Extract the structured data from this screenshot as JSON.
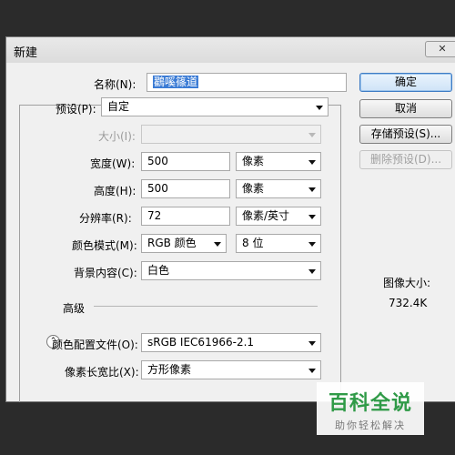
{
  "dialog": {
    "title": "新建",
    "close_label": "✕"
  },
  "form": {
    "name_label": "名称(N):",
    "name_value": "鸐嗘篠道",
    "preset_label": "预设(P):",
    "preset_value": "自定",
    "size_label": "大小(I):",
    "size_value": "",
    "width_label": "宽度(W):",
    "width_value": "500",
    "width_unit": "像素",
    "height_label": "高度(H):",
    "height_value": "500",
    "height_unit": "像素",
    "resolution_label": "分辨率(R):",
    "resolution_value": "72",
    "resolution_unit": "像素/英寸",
    "color_mode_label": "颜色模式(M):",
    "color_mode_value": "RGB 颜色",
    "bit_depth_value": "8 位",
    "background_label": "背景内容(C):",
    "background_value": "白色",
    "advanced_label": "高级",
    "color_profile_label": "颜色配置文件(O):",
    "color_profile_value": "sRGB IEC61966-2.1",
    "pixel_aspect_label": "像素长宽比(X):",
    "pixel_aspect_value": "方形像素"
  },
  "buttons": {
    "ok": "确定",
    "cancel": "取消",
    "save_preset": "存储预设(S)...",
    "delete_preset": "删除预设(D)..."
  },
  "image_size": {
    "label": "图像大小:",
    "value": "732.4K"
  },
  "watermark": {
    "logo": "百科全说",
    "slogan": "助你轻松解决"
  },
  "colors": {
    "accent": "#3a7bd5",
    "watermark_green": "#2f9a47"
  }
}
